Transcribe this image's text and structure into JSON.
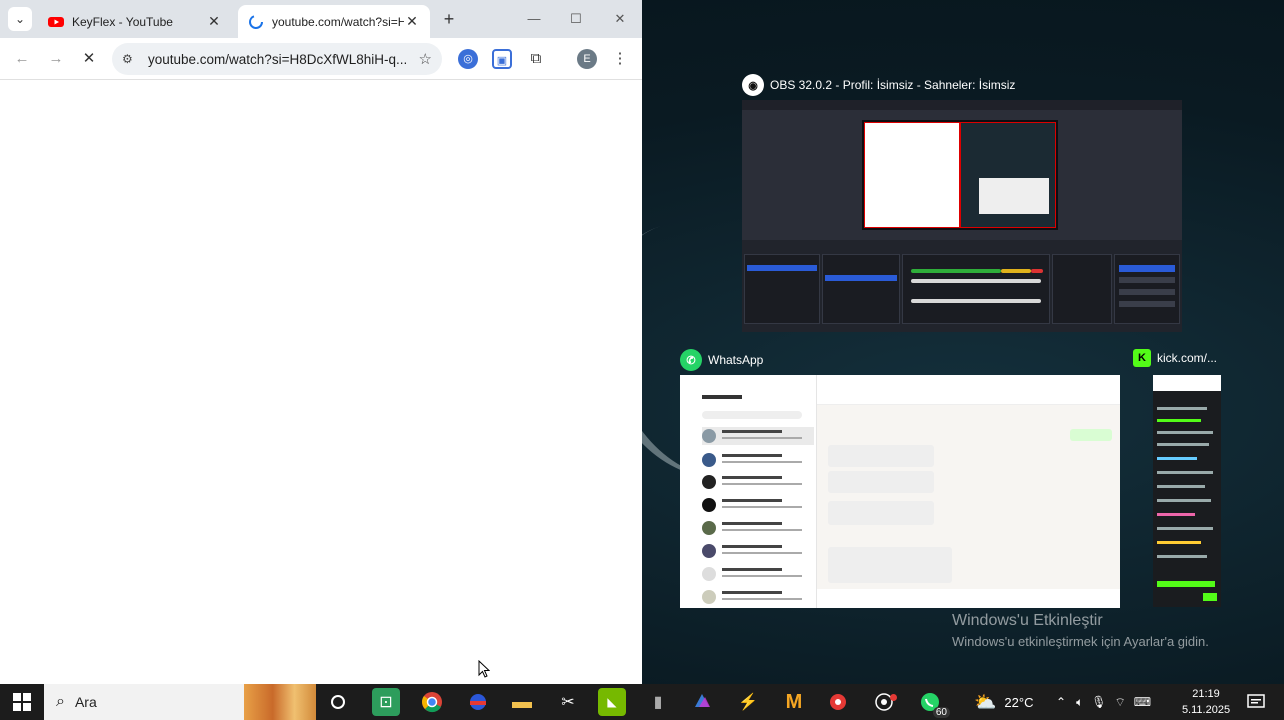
{
  "browser": {
    "tabs": [
      {
        "title": "KeyFlex - YouTube",
        "active": false
      },
      {
        "title": "youtube.com/watch?si=H8",
        "active": true
      }
    ],
    "address": "youtube.com/watch?si=H8DcXfWL8hiH-q...",
    "profile_initial": "E"
  },
  "task_view": {
    "obs_title": "OBS 32.0.2 - Profil: İsimsiz - Sahneler: İsimsiz",
    "whatsapp_title": "WhatsApp",
    "kick_title": "kick.com/..."
  },
  "activation": {
    "title": "Windows'u Etkinleştir",
    "subtitle": "Windows'u etkinleştirmek için Ayarlar'a gidin."
  },
  "taskbar": {
    "search_label": "Ara",
    "temperature": "22°C",
    "time": "21:19",
    "date": "5.11.2025",
    "whatsapp_badge": "60"
  },
  "colors": {
    "youtube_red": "#ff0000",
    "whatsapp_green": "#25d366",
    "kick_green": "#53fc18",
    "obs_selection": "#d00000"
  }
}
